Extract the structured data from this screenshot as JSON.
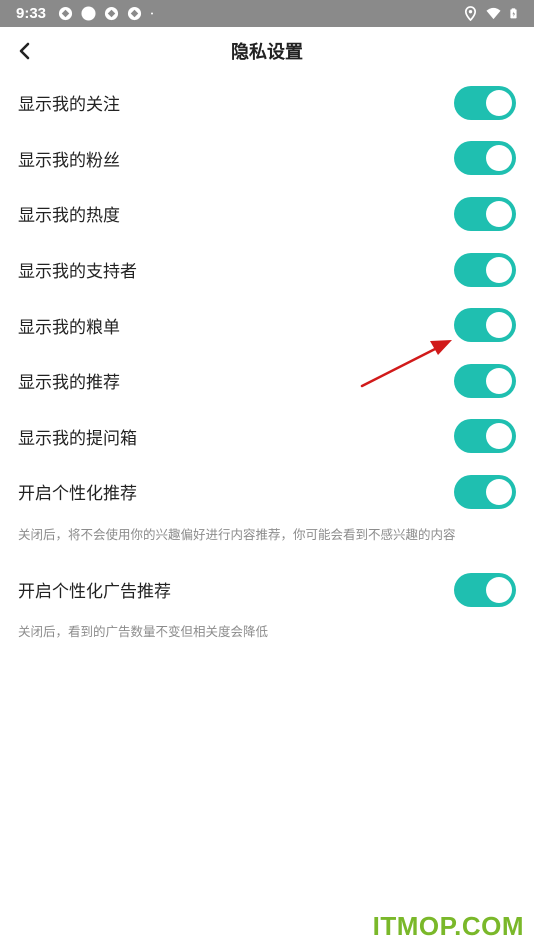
{
  "status_bar": {
    "time": "9:33"
  },
  "header": {
    "title": "隐私设置"
  },
  "settings": [
    {
      "label": "显示我的关注",
      "enabled": true
    },
    {
      "label": "显示我的粉丝",
      "enabled": true
    },
    {
      "label": "显示我的热度",
      "enabled": true
    },
    {
      "label": "显示我的支持者",
      "enabled": true
    },
    {
      "label": "显示我的粮单",
      "enabled": true
    },
    {
      "label": "显示我的推荐",
      "enabled": true
    },
    {
      "label": "显示我的提问箱",
      "enabled": true
    },
    {
      "label": "开启个性化推荐",
      "enabled": true,
      "note": "关闭后，将不会使用你的兴趣偏好进行内容推荐，你可能会看到不感兴趣的内容"
    },
    {
      "label": "开启个性化广告推荐",
      "enabled": true,
      "note": "关闭后，看到的广告数量不变但相关度会降低"
    }
  ],
  "watermark": "ITMOP.COM",
  "colors": {
    "toggle_on": "#1fbfb0",
    "annotation_arrow": "#d11a1a",
    "watermark": "#7ab82a"
  }
}
